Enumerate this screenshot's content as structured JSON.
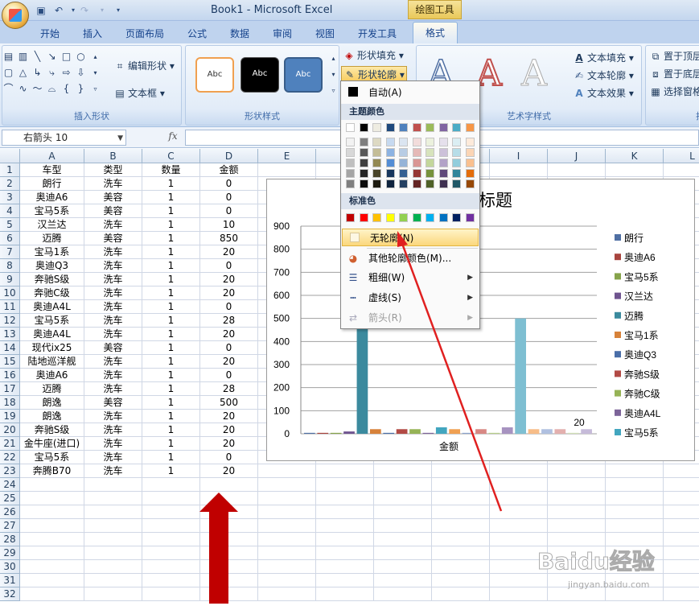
{
  "title_bar": {
    "app_title": "Book1 - Microsoft Excel",
    "context_tab": "绘图工具"
  },
  "tabs": [
    "开始",
    "插入",
    "页面布局",
    "公式",
    "数据",
    "审阅",
    "视图",
    "开发工具",
    "格式"
  ],
  "ribbon": {
    "insert_shapes": {
      "label": "插入形状",
      "edit_shape": "编辑形状",
      "text_box": "文本框"
    },
    "shape_styles": {
      "label": "形状样式",
      "sample_text": "Abc",
      "fill": "形状填充",
      "outline": "形状轮廓"
    },
    "wordart": {
      "label": "艺术字样式",
      "text_fill": "文本填充",
      "text_outline": "文本轮廓",
      "text_effect": "文本效果",
      "glyph": "A"
    },
    "arrange": {
      "bring_front": "置于顶层",
      "send_back": "置于底层",
      "selection_pane": "选择窗格",
      "cut_label": "排"
    }
  },
  "formula_bar": {
    "name_box": "右箭头 10",
    "fx": "fx"
  },
  "sheet": {
    "columns": [
      "A",
      "B",
      "C",
      "D",
      "E",
      "F",
      "G",
      "H",
      "I",
      "J",
      "K",
      "L"
    ],
    "row_numbers": [
      "1",
      "2",
      "3",
      "4",
      "5",
      "6",
      "7",
      "8",
      "9",
      "10",
      "11",
      "12",
      "13",
      "14",
      "15",
      "16",
      "17",
      "18",
      "19",
      "20",
      "21",
      "22",
      "23",
      "24",
      "25",
      "26",
      "27",
      "28",
      "29",
      "30",
      "31",
      "32"
    ],
    "rows": [
      [
        "车型",
        "类型",
        "数量",
        "金额"
      ],
      [
        "朗行",
        "洗车",
        "1",
        "0"
      ],
      [
        "奥迪A6",
        "美容",
        "1",
        "0"
      ],
      [
        "宝马5系",
        "美容",
        "1",
        "0"
      ],
      [
        "汉兰达",
        "洗车",
        "1",
        "10"
      ],
      [
        "迈腾",
        "美容",
        "1",
        "850"
      ],
      [
        "宝马1系",
        "洗车",
        "1",
        "20"
      ],
      [
        "奥迪Q3",
        "洗车",
        "1",
        "0"
      ],
      [
        "奔驰S级",
        "洗车",
        "1",
        "20"
      ],
      [
        "奔驰C级",
        "洗车",
        "1",
        "20"
      ],
      [
        "奥迪A4L",
        "洗车",
        "1",
        "0"
      ],
      [
        "宝马5系",
        "洗车",
        "1",
        "28"
      ],
      [
        "奥迪A4L",
        "洗车",
        "1",
        "20"
      ],
      [
        "现代ix25",
        "美容",
        "1",
        "0"
      ],
      [
        "陆地巡洋舰",
        "洗车",
        "1",
        "20"
      ],
      [
        "奥迪A6",
        "洗车",
        "1",
        "0"
      ],
      [
        "迈腾",
        "洗车",
        "1",
        "28"
      ],
      [
        "朗逸",
        "美容",
        "1",
        "500"
      ],
      [
        "朗逸",
        "洗车",
        "1",
        "20"
      ],
      [
        "奔驰S级",
        "洗车",
        "1",
        "20"
      ],
      [
        "金牛座(进口)",
        "洗车",
        "1",
        "20"
      ],
      [
        "宝马5系",
        "洗车",
        "1",
        "0"
      ],
      [
        "奔腾B70",
        "洗车",
        "1",
        "20"
      ]
    ]
  },
  "chart_data": {
    "type": "bar",
    "title": "标题",
    "xlabel": "金额",
    "ylim": [
      0,
      900
    ],
    "yticks": [
      "0",
      "100",
      "200",
      "300",
      "400",
      "500",
      "600",
      "700",
      "800",
      "900"
    ],
    "data_label": "20",
    "series": [
      {
        "name": "朗行",
        "value": 0,
        "color": "#4f6fa3"
      },
      {
        "name": "奥迪A6",
        "value": 0,
        "color": "#a8443e"
      },
      {
        "name": "宝马5系",
        "value": 0,
        "color": "#86a34b"
      },
      {
        "name": "汉兰达",
        "value": 10,
        "color": "#6f548f"
      },
      {
        "name": "迈腾",
        "value": 850,
        "color": "#3b8a9e"
      },
      {
        "name": "宝马1系",
        "value": 20,
        "color": "#d7823a"
      },
      {
        "name": "奥迪Q3",
        "value": 0,
        "color": "#4a6ea8"
      },
      {
        "name": "奔驰S级",
        "value": 20,
        "color": "#b24a45"
      },
      {
        "name": "奔驰C级",
        "value": 20,
        "color": "#96b356"
      },
      {
        "name": "奥迪A4L",
        "value": 0,
        "color": "#7c6499"
      },
      {
        "name": "宝马5系",
        "value": 28,
        "color": "#42a6bf"
      },
      {
        "name": "奥迪A4L",
        "value": 20,
        "color": "#f0a052"
      },
      {
        "name": "现代ix25",
        "value": 0,
        "color": "#8aa2cc"
      },
      {
        "name": "陆地巡洋舰",
        "value": 20,
        "color": "#d88884"
      },
      {
        "name": "奥迪A6",
        "value": 0,
        "color": "#b8cf8a"
      },
      {
        "name": "迈腾",
        "value": 28,
        "color": "#a793c0"
      },
      {
        "name": "朗逸",
        "value": 500,
        "color": "#7ebfd2"
      },
      {
        "name": "朗逸",
        "value": 20,
        "color": "#f7bd88"
      },
      {
        "name": "奔驰S级",
        "value": 20,
        "color": "#b0c0e0"
      },
      {
        "name": "金牛座(进口)",
        "value": 20,
        "color": "#e3b0ae"
      },
      {
        "name": "宝马5系",
        "value": 0,
        "color": "#d1e0b6"
      },
      {
        "name": "奔腾B70",
        "value": 20,
        "color": "#c6bbd9"
      }
    ],
    "legend_shown": [
      "朗行",
      "奥迪A6",
      "宝马5系",
      "汉兰达",
      "迈腾",
      "宝马1系",
      "奥迪Q3",
      "奔驰S级",
      "奔驰C级",
      "奥迪A4L",
      "宝马5系"
    ]
  },
  "outline_menu": {
    "auto": "自动(A)",
    "theme_colors_header": "主题颜色",
    "standard_colors_header": "标准色",
    "no_outline": "无轮廓(N)",
    "more_colors": "其他轮廓颜色(M)...",
    "weight": "粗细(W)",
    "dashes": "虚线(S)",
    "arrows": "箭头(R)",
    "theme_top": [
      "#ffffff",
      "#000000",
      "#eeece1",
      "#1f497d",
      "#4f81bd",
      "#c0504d",
      "#9bbb59",
      "#8064a2",
      "#4bacc6",
      "#f79646"
    ],
    "theme_shades": [
      [
        "#f2f2f2",
        "#7f7f7f",
        "#ddd9c3",
        "#c6d9f0",
        "#dbe5f1",
        "#f2dcdb",
        "#ebf1dd",
        "#e5e0ec",
        "#dbeef3",
        "#fdeada"
      ],
      [
        "#d8d8d8",
        "#595959",
        "#c4bd97",
        "#8db3e2",
        "#b8cce4",
        "#e5b9b7",
        "#d7e3bc",
        "#ccc1d9",
        "#b7dde8",
        "#fbd5b5"
      ],
      [
        "#bfbfbf",
        "#3f3f3f",
        "#938953",
        "#548dd4",
        "#95b3d7",
        "#d99694",
        "#c3d69b",
        "#b2a2c7",
        "#92cddc",
        "#fac08f"
      ],
      [
        "#a5a5a5",
        "#262626",
        "#494429",
        "#17365d",
        "#366092",
        "#953734",
        "#76923c",
        "#5f497a",
        "#31859b",
        "#e36c09"
      ],
      [
        "#7f7f7f",
        "#0c0c0c",
        "#1d1b10",
        "#0f243e",
        "#244061",
        "#632423",
        "#4f6128",
        "#3f3151",
        "#205867",
        "#974806"
      ]
    ],
    "standard": [
      "#c00000",
      "#ff0000",
      "#ffc000",
      "#ffff00",
      "#92d050",
      "#00b050",
      "#00b0f0",
      "#0070c0",
      "#002060",
      "#7030a0"
    ]
  },
  "watermark": {
    "brand": "Baidu经验",
    "url": "jingyan.baidu.com"
  },
  "accent_color": "#c00000"
}
